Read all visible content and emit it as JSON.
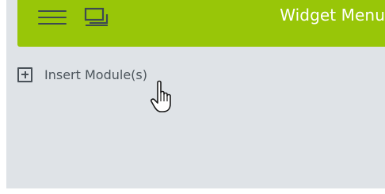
{
  "header": {
    "title": "Widget Menu",
    "menu_icon": "hamburger-menu-icon",
    "windows_icon": "windows-icon",
    "background_color": "#98c608"
  },
  "content": {
    "insert_label": "Insert Module(s)",
    "insert_icon": "plus-square-icon",
    "background_color": "#dfe3e7"
  },
  "cursor": {
    "icon": "hand-pointer-cursor-icon"
  }
}
